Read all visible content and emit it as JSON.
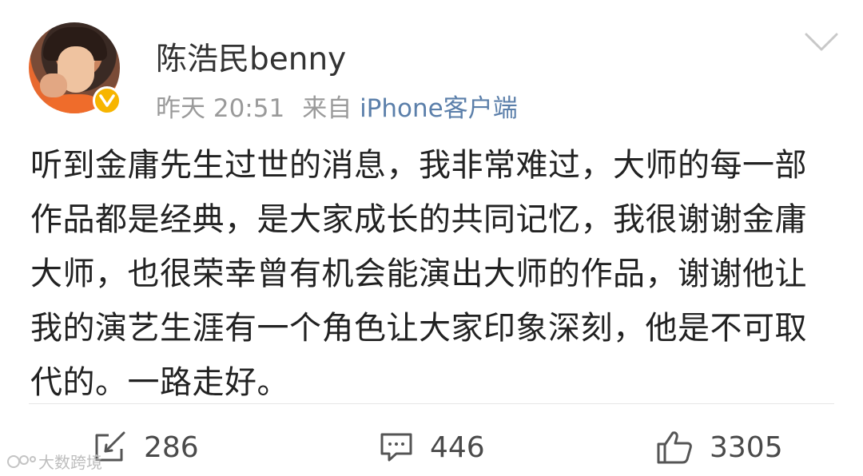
{
  "post": {
    "username": "陈浩民benny",
    "time": "昨天 20:51",
    "from_label": "来自",
    "source": "iPhone客户端",
    "content": "听到金庸先生过世的消息，我非常难过，大师的每一部作品都是经典，是大家成长的共同记忆，我很谢谢金庸大师，也很荣幸曾有机会能演出大师的作品，谢谢他让我的演艺生涯有一个角色让大家印象深刻，他是不可取代的。一路走好。",
    "verified_badge": "v-icon",
    "colors": {
      "link": "#5b7faa",
      "badge": "#f7b500",
      "meta": "#9a9a9a"
    }
  },
  "actions": {
    "repost_count": "286",
    "comment_count": "446",
    "like_count": "3305"
  },
  "watermark": {
    "text": "大数跨境"
  }
}
